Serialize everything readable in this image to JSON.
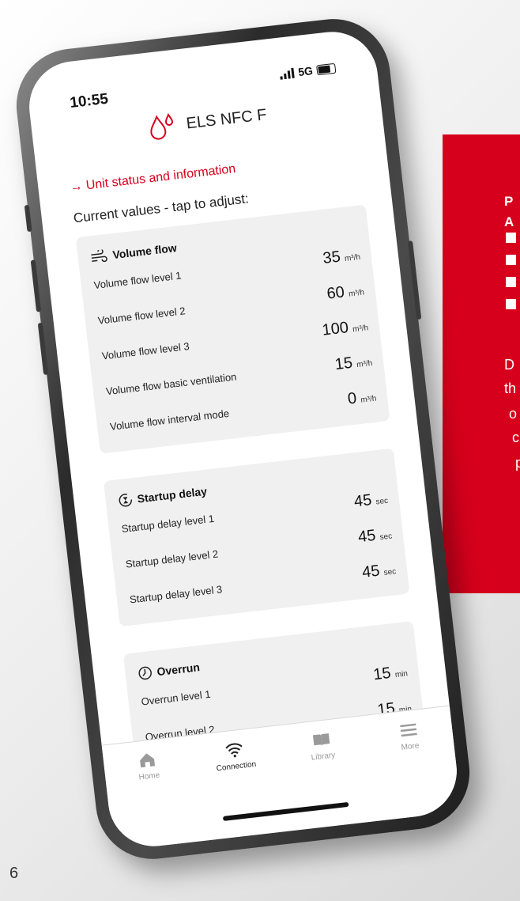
{
  "status": {
    "time": "10:55",
    "network": "5G"
  },
  "app": {
    "title": "ELS NFC F"
  },
  "nav": {
    "unit_link": "Unit status and information"
  },
  "current_label": "Current values - tap to adjust:",
  "cards": [
    {
      "title": "Volume flow",
      "icon": "wind-icon",
      "rows": [
        {
          "label": "Volume flow level 1",
          "value": "35",
          "unit": "m³/h"
        },
        {
          "label": "Volume flow level 2",
          "value": "60",
          "unit": "m³/h"
        },
        {
          "label": "Volume flow level 3",
          "value": "100",
          "unit": "m³/h"
        },
        {
          "label": "Volume flow basic ventilation",
          "value": "15",
          "unit": "m³/h"
        },
        {
          "label": "Volume flow interval mode",
          "value": "0",
          "unit": "m³/h"
        }
      ]
    },
    {
      "title": "Startup delay",
      "icon": "startup-delay-icon",
      "rows": [
        {
          "label": "Startup delay level 1",
          "value": "45",
          "unit": "sec"
        },
        {
          "label": "Startup delay level 2",
          "value": "45",
          "unit": "sec"
        },
        {
          "label": "Startup delay level 3",
          "value": "45",
          "unit": "sec"
        }
      ]
    },
    {
      "title": "Overrun",
      "icon": "clock-icon",
      "rows": [
        {
          "label": "Overrun level 1",
          "value": "15",
          "unit": "min"
        },
        {
          "label": "Overrun level 2",
          "value": "15",
          "unit": "min"
        }
      ]
    }
  ],
  "tabs": [
    {
      "label": "Home",
      "icon": "home-icon"
    },
    {
      "label": "Connection",
      "icon": "wifi-icon",
      "active": true
    },
    {
      "label": "Library",
      "icon": "book-icon"
    },
    {
      "label": "More",
      "icon": "menu-icon"
    }
  ],
  "promo": {
    "heading_1": "P",
    "heading_2": "A",
    "text_1": "D",
    "text_2": "th",
    "text_3": "o",
    "text_4": "c",
    "text_5": "p"
  },
  "page_number": "6",
  "colors": {
    "accent": "#d6001c"
  }
}
